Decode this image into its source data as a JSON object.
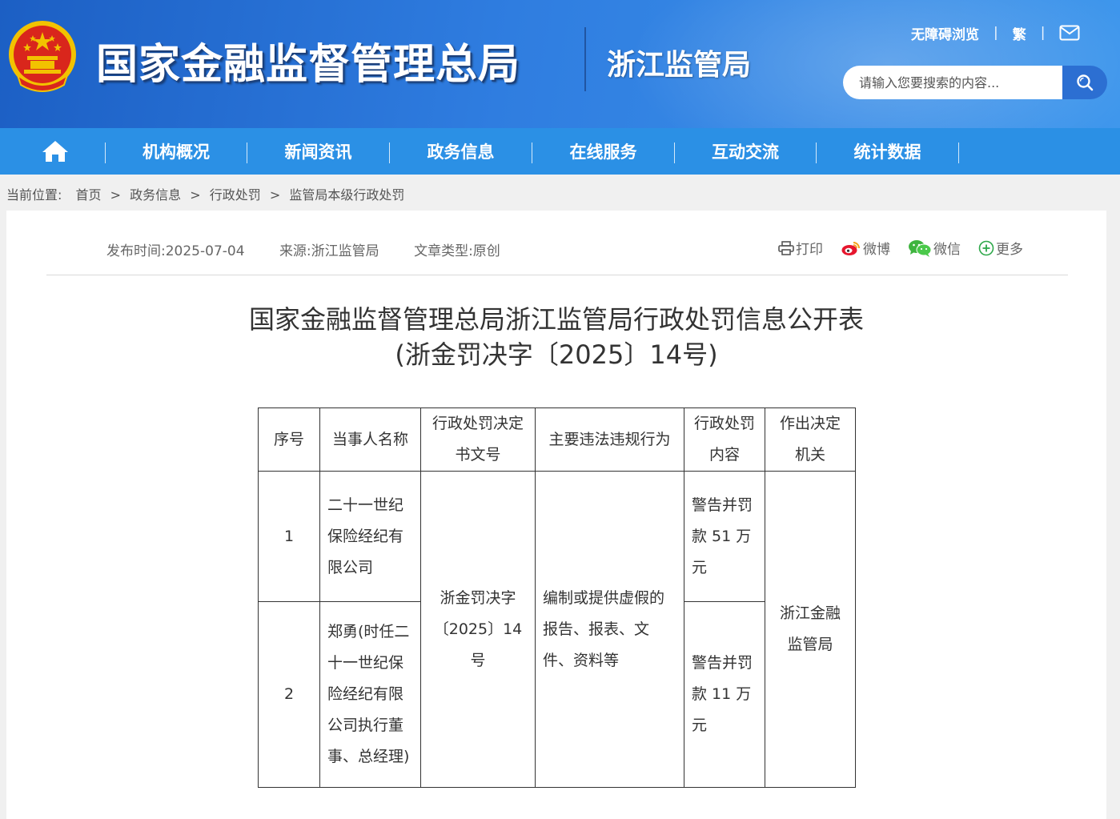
{
  "header": {
    "site_title": "国家金融监督管理总局",
    "sub_title": "浙江监管局",
    "accessibility_link": "无障碍浏览",
    "traditional_link": "繁",
    "search_placeholder": "请输入您要搜索的内容..."
  },
  "nav": {
    "items": [
      "机构概况",
      "新闻资讯",
      "政务信息",
      "在线服务",
      "互动交流",
      "统计数据"
    ]
  },
  "breadcrumb": {
    "label": "当前位置:",
    "items": [
      "首页",
      "政务信息",
      "行政处罚",
      "监管局本级行政处罚"
    ]
  },
  "article": {
    "publish_time": "发布时间:2025-07-04",
    "source": "来源:浙江监管局",
    "article_type": "文章类型:原创",
    "share": {
      "print": "打印",
      "weibo": "微博",
      "wechat": "微信",
      "more": "更多"
    },
    "title_line1": "国家金融监督管理总局浙江监管局行政处罚信息公开表",
    "title_line2": "(浙金罚决字〔2025〕14号)"
  },
  "table": {
    "headers": [
      "序号",
      "当事人名称",
      "行政处罚决定书文号",
      "主要违法违规行为",
      "行政处罚内容",
      "作出决定机关"
    ],
    "rows": [
      {
        "no": "1",
        "party": "二十一世纪保险经纪有限公司",
        "penalty": "警告并罚款 51 万元"
      },
      {
        "no": "2",
        "party": "郑勇(时任二十一世纪保险经纪有限公司执行董事、总经理)",
        "penalty": "警告并罚款 11 万元"
      }
    ],
    "decision_no": "浙金罚决字〔2025〕14号",
    "violation": "编制或提供虚假的报告、报表、文件、资料等",
    "authority": "浙江金融监管局"
  },
  "colors": {
    "header_blue": "#2f7de0",
    "nav_blue": "#2b90e5",
    "search_button": "#2c6fd2",
    "emblem_red": "#d9261c",
    "emblem_gold": "#f2c200"
  }
}
